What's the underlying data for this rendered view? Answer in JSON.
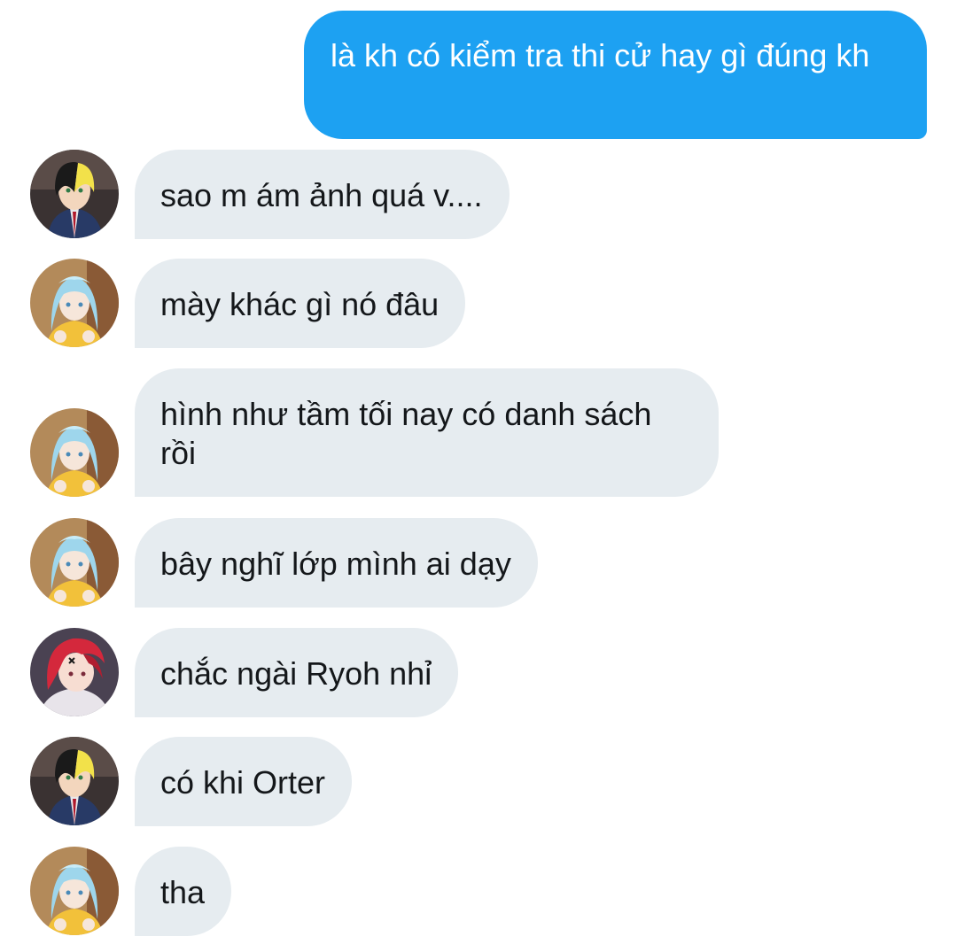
{
  "conversation": {
    "outgoing": {
      "text": "là kh có kiểm tra thi cử hay gì đúng kh"
    },
    "incoming": [
      {
        "avatar": "yellow-black-hair-avatar-icon",
        "text": "sao m ám ảnh quá v...."
      },
      {
        "avatar": "light-blue-hair-avatar-icon",
        "text": "mày khác gì nó đâu"
      },
      {
        "avatar": "light-blue-hair-avatar-icon",
        "text": "hình như tầm tối nay có danh sách rồi"
      },
      {
        "avatar": "light-blue-hair-avatar-icon",
        "text": "bây nghĩ lớp mình ai dạy"
      },
      {
        "avatar": "red-hair-avatar-icon",
        "text": "chắc ngài Ryoh nhỉ"
      },
      {
        "avatar": "yellow-black-hair-avatar-icon",
        "text": "có khi Orter"
      },
      {
        "avatar": "light-blue-hair-avatar-icon",
        "text": "tha"
      }
    ]
  },
  "colors": {
    "outgoing_bubble": "#1da1f2",
    "incoming_bubble": "#e6ecf0",
    "incoming_text": "#14171a",
    "outgoing_text": "#ffffff"
  }
}
